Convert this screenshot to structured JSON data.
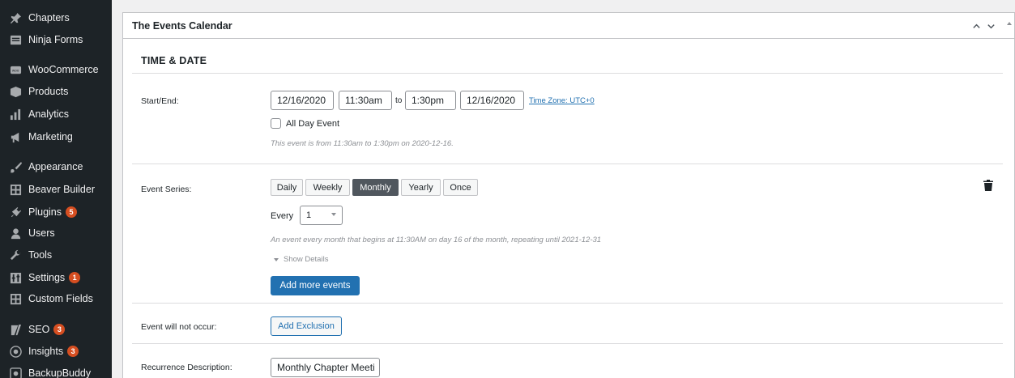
{
  "sidebar": {
    "items": [
      {
        "label": "Chapters",
        "icon": "pin-icon"
      },
      {
        "label": "Ninja Forms",
        "icon": "ninja-forms-icon"
      },
      {
        "label": "WooCommerce",
        "icon": "woo-icon"
      },
      {
        "label": "Products",
        "icon": "products-icon"
      },
      {
        "label": "Analytics",
        "icon": "analytics-icon"
      },
      {
        "label": "Marketing",
        "icon": "megaphone-icon"
      },
      {
        "label": "Appearance",
        "icon": "brush-icon"
      },
      {
        "label": "Beaver Builder",
        "icon": "grid-icon"
      },
      {
        "label": "Plugins",
        "icon": "plug-icon",
        "badge": "5"
      },
      {
        "label": "Users",
        "icon": "users-icon"
      },
      {
        "label": "Tools",
        "icon": "wrench-icon"
      },
      {
        "label": "Settings",
        "icon": "settings-icon",
        "badge": "1"
      },
      {
        "label": "Custom Fields",
        "icon": "grid-icon"
      },
      {
        "label": "SEO",
        "icon": "yoast-icon",
        "badge": "3"
      },
      {
        "label": "Insights",
        "icon": "insights-icon",
        "badge": "3"
      },
      {
        "label": "BackupBuddy",
        "icon": "backup-icon"
      }
    ]
  },
  "panel": {
    "title": "The Events Calendar",
    "section_title": "TIME & DATE"
  },
  "time_date": {
    "label": "Start/End:",
    "start_date": "12/16/2020",
    "start_time": "11:30am",
    "to": "to",
    "end_time": "1:30pm",
    "end_date": "12/16/2020",
    "timezone_link": "Time Zone: UTC+0",
    "all_day_label": "All Day Event",
    "all_day_checked": false,
    "hint": "This event is from 11:30am to 1:30pm on 2020-12-16."
  },
  "series": {
    "label": "Event Series:",
    "options": [
      "Daily",
      "Weekly",
      "Monthly",
      "Yearly",
      "Once"
    ],
    "selected": "Monthly",
    "every_label": "Every",
    "every_value": "1",
    "description": "An event every month that begins at 11:30AM on day 16 of the month, repeating until 2021-12-31",
    "show_details": "Show Details",
    "add_more": "Add more events"
  },
  "exclusion": {
    "label": "Event will not occur:",
    "button": "Add Exclusion"
  },
  "recurrence": {
    "label": "Recurrence Description:",
    "value": "Monthly Chapter Meeti"
  },
  "colors": {
    "sidebar_bg": "#1d2327",
    "accent": "#2271b1",
    "badge": "#d54e21",
    "active_segment": "#50575e"
  }
}
